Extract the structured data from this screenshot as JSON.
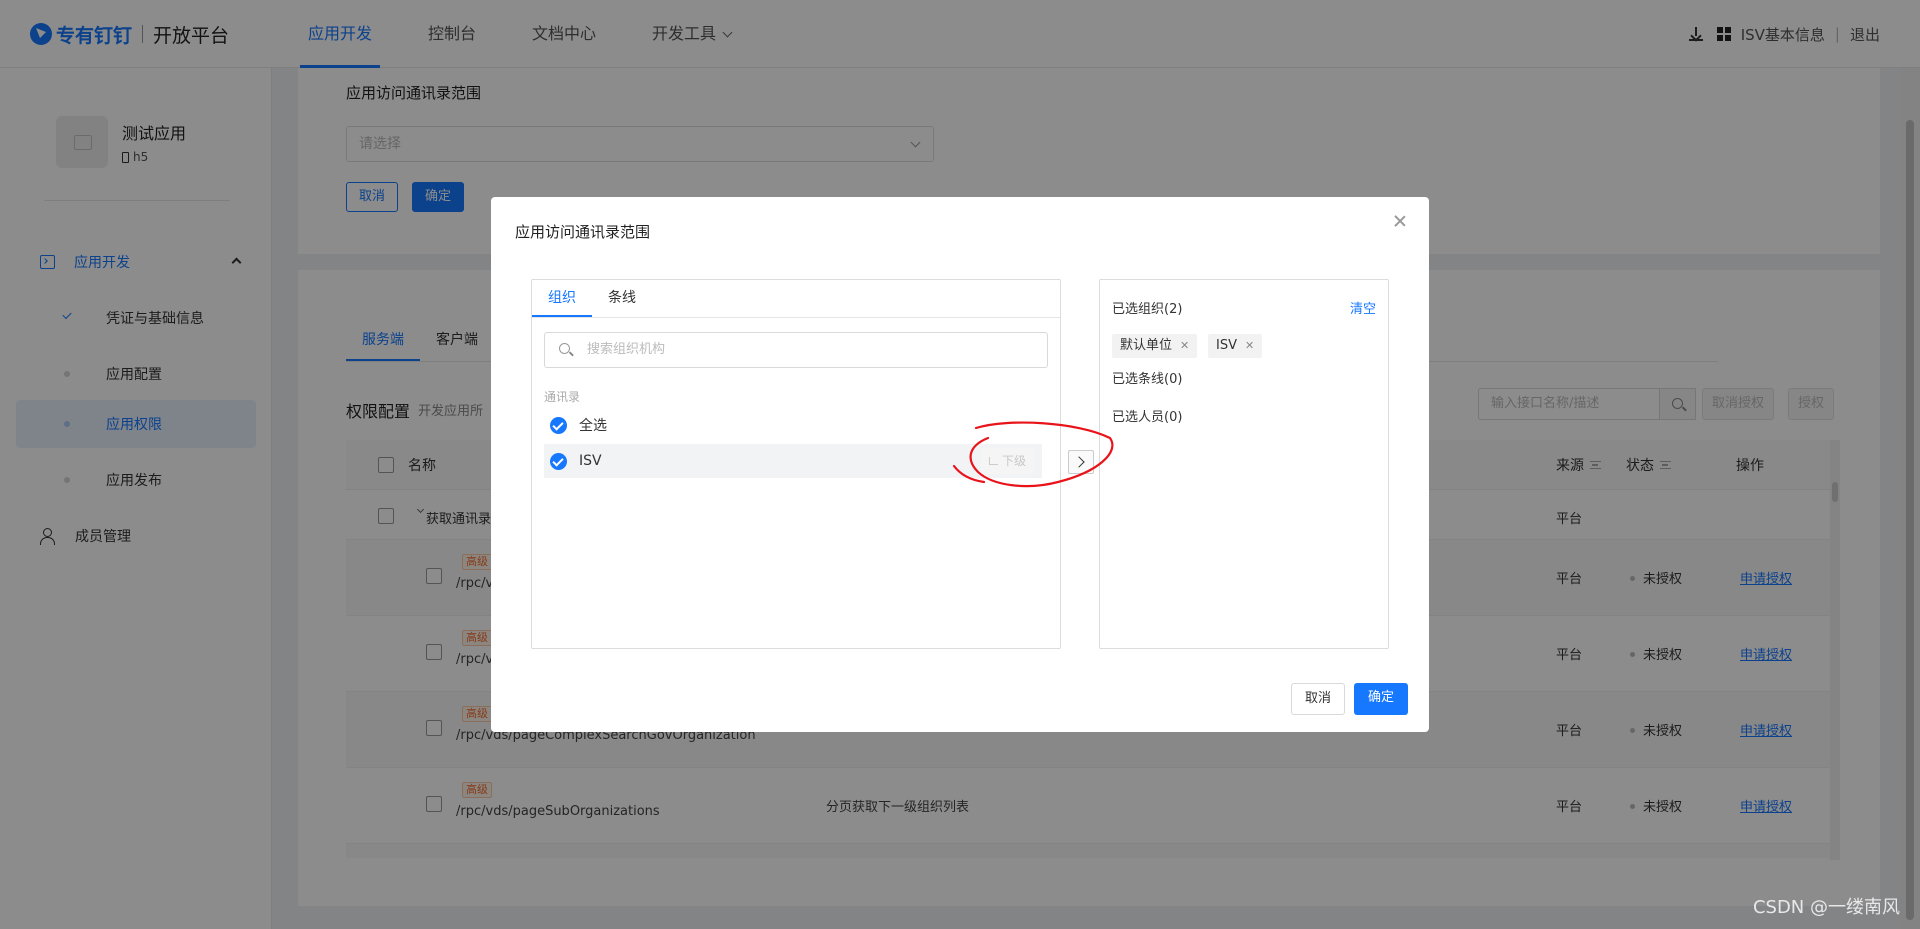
{
  "header": {
    "brand": "专有钉钉",
    "platform": "开放平台",
    "nav": [
      "应用开发",
      "控制台",
      "文档中心",
      "开发工具"
    ],
    "right": {
      "isv_info": "ISV基本信息",
      "logout": "退出"
    }
  },
  "sidebar": {
    "app_name": "测试应用",
    "app_type": "h5",
    "group": "应用开发",
    "items": [
      "凭证与基础信息",
      "应用配置",
      "应用权限",
      "应用发布"
    ],
    "member": "成员管理"
  },
  "scope_section": {
    "title": "应用访问通讯录范围",
    "select_placeholder": "请选择",
    "cancel": "取消",
    "ok": "确定"
  },
  "perm_section": {
    "tabs": [
      "服务端",
      "客户端"
    ],
    "title": "权限配置",
    "desc": "开发应用所",
    "search_placeholder": "输入接口名称/描述",
    "btn_cancel_auth": "取消授权",
    "btn_auth": "授权",
    "columns": {
      "name": "名称",
      "source": "来源",
      "status": "状态",
      "action": "操作"
    },
    "group": {
      "name": "获取通讯录",
      "source": "平台"
    },
    "rows": [
      {
        "tag": "高级",
        "path": "/rpc/v",
        "desc": "",
        "source": "平台",
        "status": "未授权",
        "action": "申请授权"
      },
      {
        "tag": "高级",
        "path": "/rpc/v",
        "desc": "",
        "source": "平台",
        "status": "未授权",
        "action": "申请授权"
      },
      {
        "tag": "高级",
        "path": "/rpc/vds/pageComplexSearchGovOrganization",
        "desc": "",
        "source": "平台",
        "status": "未授权",
        "action": "申请授权"
      },
      {
        "tag": "高级",
        "path": "/rpc/vds/pageSubOrganizations",
        "desc": "分页获取下一级组织列表",
        "source": "平台",
        "status": "未授权",
        "action": "申请授权"
      }
    ]
  },
  "modal": {
    "title": "应用访问通讯录范围",
    "tabs": [
      "组织",
      "条线"
    ],
    "search_placeholder": "搜索组织机构",
    "group_label": "通讯录",
    "select_all": "全选",
    "items": [
      {
        "label": "ISV",
        "sub_btn": "下级"
      }
    ],
    "right": {
      "selected_orgs": "已选组织(2)",
      "clear": "清空",
      "chips": [
        "默认单位",
        "ISV"
      ],
      "selected_lines": "已选条线(0)",
      "selected_people": "已选人员(0)"
    },
    "cancel": "取消",
    "ok": "确定"
  },
  "watermark": "CSDN @一缕南风",
  "colors": {
    "accent": "#1677ff",
    "annotation": "#e8141a"
  }
}
